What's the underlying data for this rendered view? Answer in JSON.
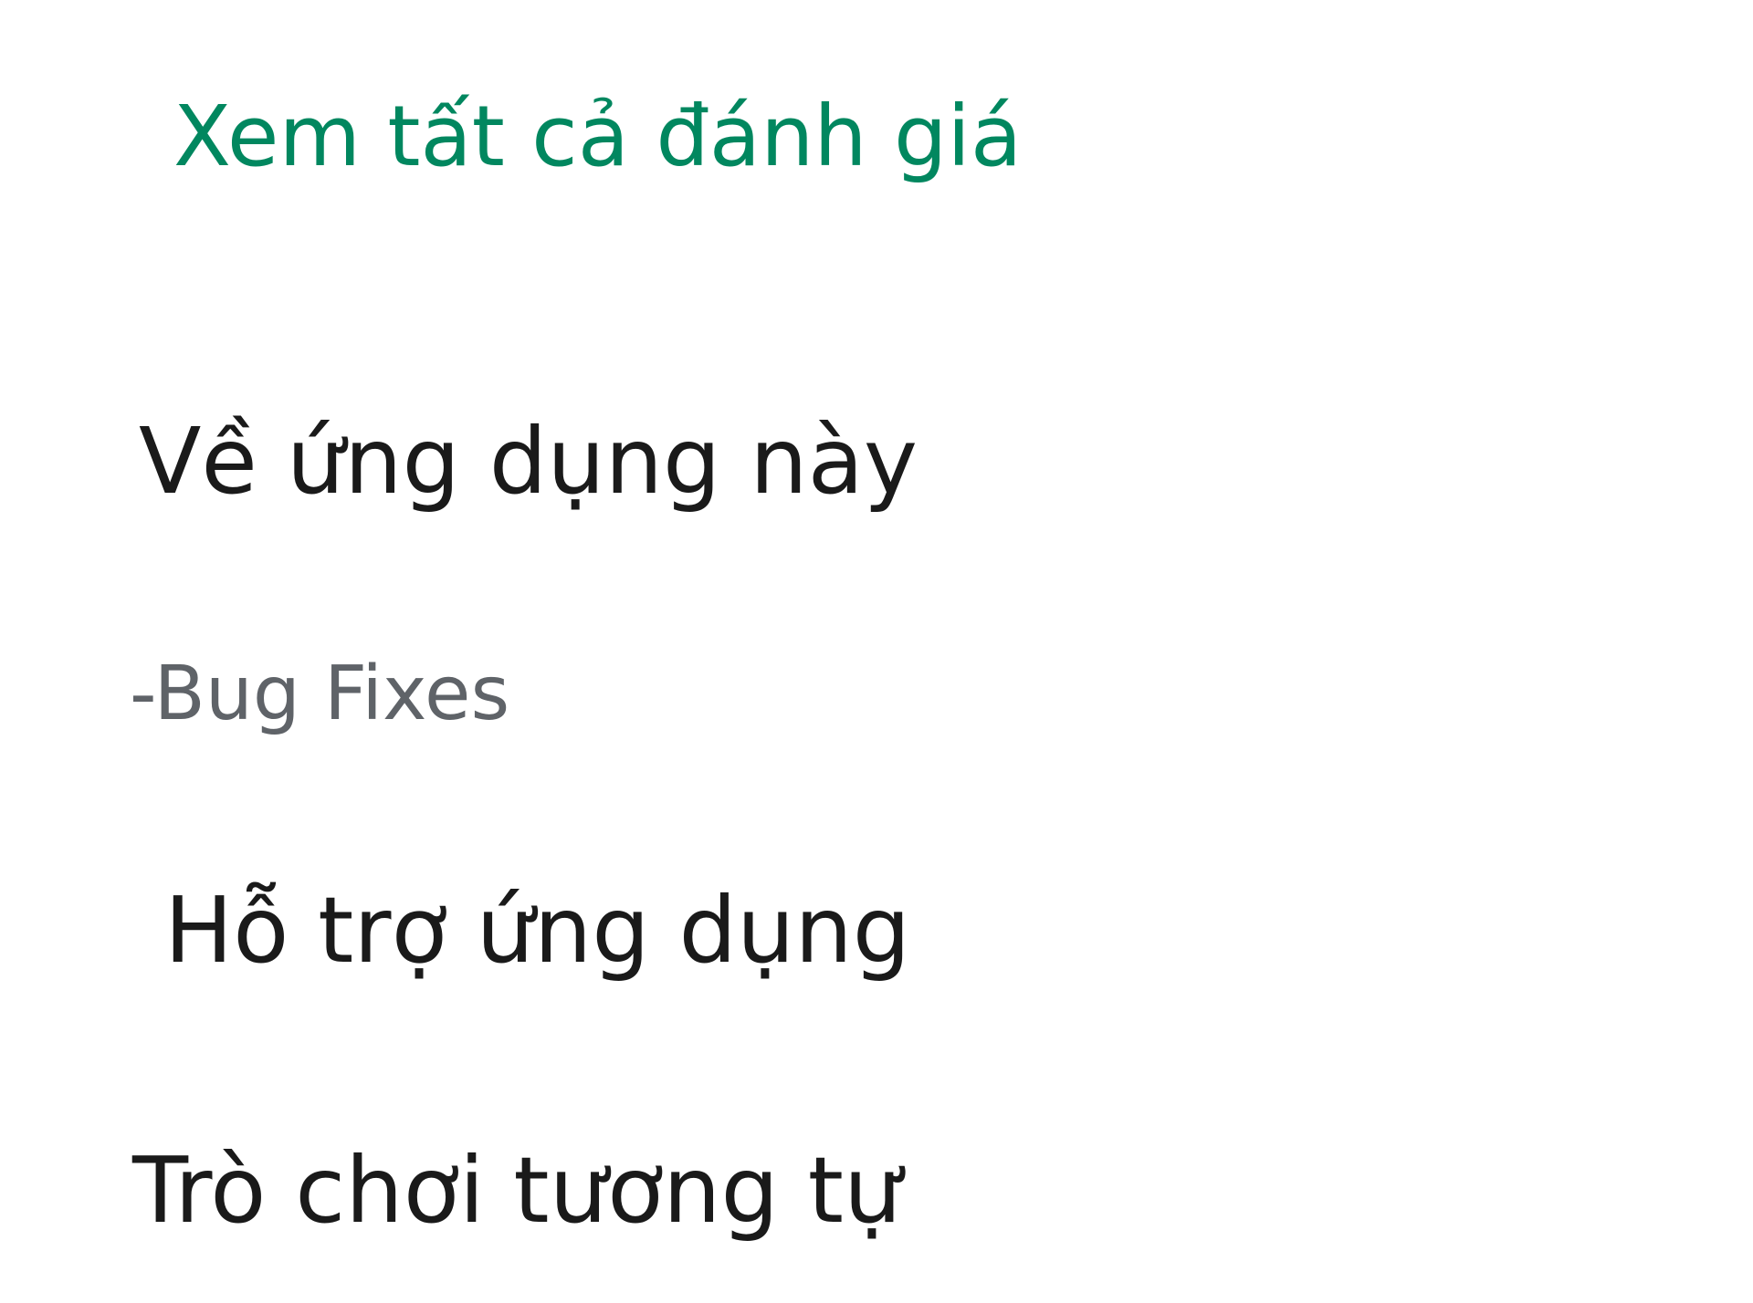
{
  "reviews": {
    "see_all_label": "Xem tất cả đánh giá"
  },
  "about": {
    "heading": "Về ứng dụng này",
    "description": "-Bug Fixes"
  },
  "support": {
    "heading": "Hỗ trợ ứng dụng"
  },
  "similar": {
    "heading": "Trò chơi tương tự"
  },
  "colors": {
    "accent": "#01875f",
    "heading_text": "#1a1a1a",
    "secondary_text": "#5f6368",
    "background": "#ffffff"
  }
}
